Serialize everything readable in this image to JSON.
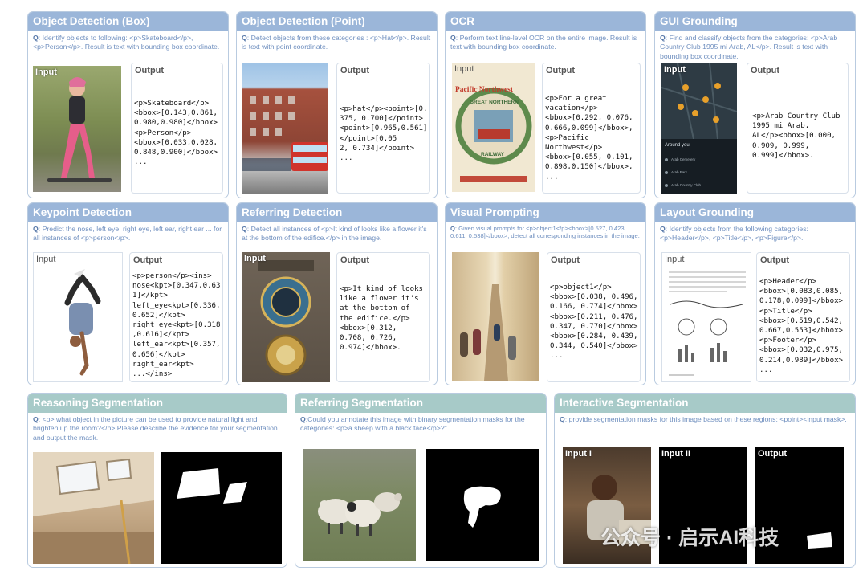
{
  "panels": {
    "obj_box": {
      "title": "Object Detection (Box)",
      "q_label": "Q",
      "question": ": Identify objects to following: <p>Skateboard</p>, <p>Person</p>. Result is text with bounding box coordinate.",
      "input_label": "Input",
      "output_label": "Output",
      "output": "<p>Skateboard</p>\n<bbox>[0.143,0.861,\n0.980,0.980]</bbox>\n<p>Person</p>\n<bbox>[0.033,0.028,\n0.848,0.900]</bbox>\n..."
    },
    "obj_point": {
      "title": "Object Detection (Point)",
      "q_label": "Q",
      "question": ": Detect objects from these categories : <p>Hat</p>. Result is text with point coordinate.",
      "output_label": "Output",
      "output": "<p>hat</p><point>[0.\n375, 0.700]</point>\n<point>[0.965,0.561]\n</point>[0.05\n2, 0.734]</point>\n..."
    },
    "ocr": {
      "title": "OCR",
      "q_label": "Q",
      "question": ": Perform text line-level OCR on the entire image. Result is text with bounding box coordinate.",
      "input_label": "Input",
      "output_label": "Output",
      "poster_top": "Pacific Northwest",
      "poster_mid": "GREAT NORTHERN",
      "poster_bottom": "RAILWAY",
      "output": "<p>For a great\nvacation</p>\n<bbox>[0.292, 0.076,\n0.666,0.099]</bbox>,\n<p>Pacific\nNorthwest</p>\n<bbox>[0.055, 0.101,\n0.898,0.150]</bbox>,\n..."
    },
    "gui": {
      "title": "GUI Grounding",
      "q_label": "Q",
      "question": ": Find and classify objects from the categories: <p>Arab Country Club 1995 mi Arab, AL</p>. Result is text with bounding box coordinate.",
      "input_label": "Input",
      "output_label": "Output",
      "phone_heading": "Around you",
      "phone_items": [
        "Arab Cemetery",
        "Arab Park",
        "Arab Country Club"
      ],
      "output": "<p>Arab Country Club\n1995 mi Arab,\nAL</p><bbox>[0.000,\n0.909, 0.999,\n0.999]</bbox>."
    },
    "keypoint": {
      "title": "Keypoint Detection",
      "q_label": "Q",
      "question": ": Predict the nose, left eye, right eye, left ear, right ear ... for all instances of <p>person</p>.",
      "input_label": "Input",
      "output_label": "Output",
      "output": "<p>person</p><ins>\nnose<kpt>[0.347,0.63\n1]</kpt>\nleft_eye<kpt>[0.336,\n0.652]</kpt>\nright_eye<kpt>[0.318\n,0.616]</kpt>\nleft_ear<kpt>[0.357,\n0.656]</kpt>\nright_ear<kpt>\n...</ins>"
    },
    "referring_det": {
      "title": "Referring Detection",
      "q_label": "Q",
      "question": ": Detect all instances of <p>It kind of looks like a flower it's at the bottom of the edifice.</p> in the image.",
      "input_label": "Input",
      "output_label": "Output",
      "output": "<p>It kind of looks\nlike a flower it's\nat the bottom of\nthe edifice.</p>\n<bbox>[0.312,\n0.708, 0.726,\n0.974]</bbox>."
    },
    "visual_prompt": {
      "title": "Visual Prompting",
      "q_label": "Q",
      "question": ": Given visual prompts for <p>object1</p><bbox>[0.527, 0.423, 0.611, 0.538]</bbox>, detect all corresponding instances in the image.",
      "output_label": "Output",
      "output": "<p>object1</p>\n<bbox>[0.038, 0.496,\n0.166, 0.774]</bbox>\n<bbox>[0.211, 0.476,\n0.347, 0.770]</bbox>\n<bbox>[0.284, 0.439,\n0.344, 0.540]</bbox>\n..."
    },
    "layout": {
      "title": "Layout Grounding",
      "q_label": "Q",
      "question": ": Identify objects from the following categories: <p>Header</p>, <p>Title</p>, <p>Figure</p>.",
      "input_label": "Input",
      "output_label": "Output",
      "output": "<p>Header</p>\n<bbox>[0.083,0.085,\n0.178,0.099]</bbox>\n<p>Title</p>\n<bbox>[0.519,0.542,\n0.667,0.553]</bbox>\n<p>Footer</p>\n<bbox>[0.032,0.975,\n0.214,0.989]</bbox>\n..."
    },
    "reasoning_seg": {
      "title": "Reasoning  Segmentation",
      "q_label": "Q",
      "question": ": <p> what object in the picture can be used to provide natural light and brighten up the room?</p> Please describe the evidence for your segmentation and output the mask."
    },
    "referring_seg": {
      "title": "Referring Segmentation",
      "q_label": "Q",
      "question": ":Could you annotate this image with binary segmentation masks for the categories: <p>a sheep with a black face</p>?\""
    },
    "interactive_seg": {
      "title": "Interactive Segmentation",
      "q_label": "Q",
      "question": ": provide segmentation masks for this image based on these regions: <point><input mask>.",
      "input1_label": "Input I",
      "input2_label": "Input II",
      "output_label": "Output"
    }
  },
  "watermark": "公众号 · 启示AI科技",
  "colors": {
    "header_blue": "#9bb6d9",
    "header_teal": "#a7cac8",
    "question_text": "#6f8fbf"
  }
}
